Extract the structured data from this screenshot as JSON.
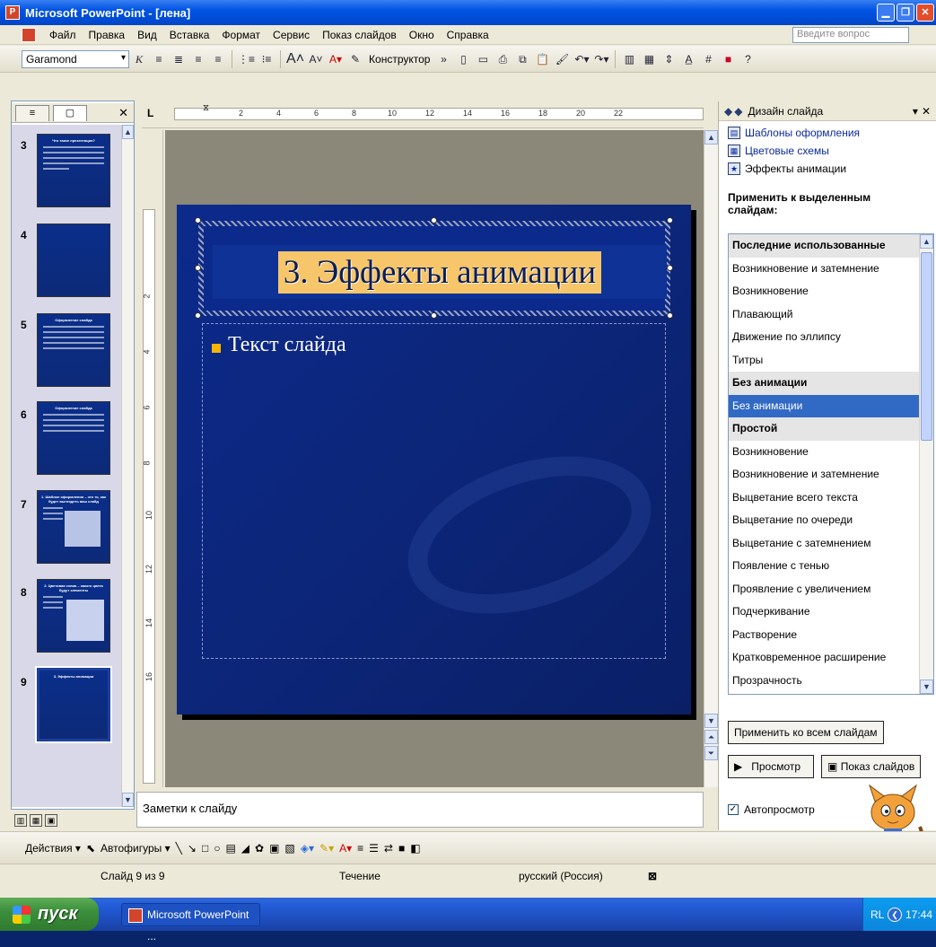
{
  "window": {
    "app_title": "Microsoft PowerPoint - [лена]"
  },
  "menu": {
    "items": [
      "Файл",
      "Правка",
      "Вид",
      "Вставка",
      "Формат",
      "Сервис",
      "Показ слайдов",
      "Окно",
      "Справка"
    ],
    "ask_placeholder": "Введите вопрос"
  },
  "toolbar": {
    "font_name": "Garamond",
    "design_label": "Конструктор"
  },
  "thumbnails": {
    "numbers": [
      "3",
      "4",
      "5",
      "6",
      "7",
      "8",
      "9"
    ],
    "slide3_title": "Что такое презентация?",
    "slide5_title": "Оформление слайда",
    "slide6_title": "Оформление слайда",
    "slide7_title": "1. Шаблон оформления – это то, как будет выглядеть ваш слайд",
    "slide8_title": "2. Цветовая схема – какого цвета будут элементы",
    "slide9_title": "3. Эффекты анимации"
  },
  "ruler": {
    "h_numbers": [
      "2",
      "4",
      "6",
      "8",
      "10",
      "12",
      "14",
      "16",
      "18",
      "20",
      "22"
    ],
    "v_numbers": [
      "2",
      "4",
      "6",
      "8",
      "10",
      "12",
      "14",
      "16"
    ]
  },
  "slide": {
    "title": "3. Эффекты анимации",
    "body_text": "Текст слайда",
    "title_bg_color": "#f7c66a",
    "background_color": "#0b2a8c",
    "bullet_color": "#f7b500"
  },
  "notes": {
    "label": "Заметки к слайду"
  },
  "taskpane": {
    "title": "Дизайн слайда",
    "links": [
      "Шаблоны оформления",
      "Цветовые схемы",
      "Эффекты анимации"
    ],
    "apply_label": "Применить к выделенным слайдам:",
    "list": [
      {
        "text": "Последние использованные",
        "kind": "header"
      },
      {
        "text": "Возникновение и затемнение",
        "kind": "item"
      },
      {
        "text": "Возникновение",
        "kind": "item"
      },
      {
        "text": "Плавающий",
        "kind": "item"
      },
      {
        "text": "Движение по эллипсу",
        "kind": "item"
      },
      {
        "text": "Титры",
        "kind": "item"
      },
      {
        "text": "Без анимации",
        "kind": "header"
      },
      {
        "text": "Без анимации",
        "kind": "selected"
      },
      {
        "text": "Простой",
        "kind": "header"
      },
      {
        "text": "Возникновение",
        "kind": "item"
      },
      {
        "text": "Возникновение и затемнение",
        "kind": "item"
      },
      {
        "text": "Выцветание всего текста",
        "kind": "item"
      },
      {
        "text": "Выцветание по очереди",
        "kind": "item"
      },
      {
        "text": "Выцветание с затемнением",
        "kind": "item"
      },
      {
        "text": "Появление с тенью",
        "kind": "item"
      },
      {
        "text": "Проявление с увеличением",
        "kind": "item"
      },
      {
        "text": "Подчеркивание",
        "kind": "item"
      },
      {
        "text": "Растворение",
        "kind": "item"
      },
      {
        "text": "Кратковременное расширение",
        "kind": "item"
      },
      {
        "text": "Прозрачность",
        "kind": "item"
      }
    ],
    "apply_all_button": "Применить ко всем слайдам",
    "preview_button": "Просмотр",
    "slideshow_button": "Показ слайдов",
    "autopreview_label": "Автопросмотр",
    "autopreview_checked": "true"
  },
  "drawing": {
    "actions_label": "Действия",
    "autoshapes_label": "Автофигуры"
  },
  "status": {
    "slide_counter": "Слайд 9 из 9",
    "design_name": "Течение",
    "language": "русский (Россия)"
  },
  "taskbar": {
    "start_label": "пуск",
    "task_item": "Microsoft PowerPoint ...",
    "tray_lang": "RL",
    "clock": "17:44"
  }
}
